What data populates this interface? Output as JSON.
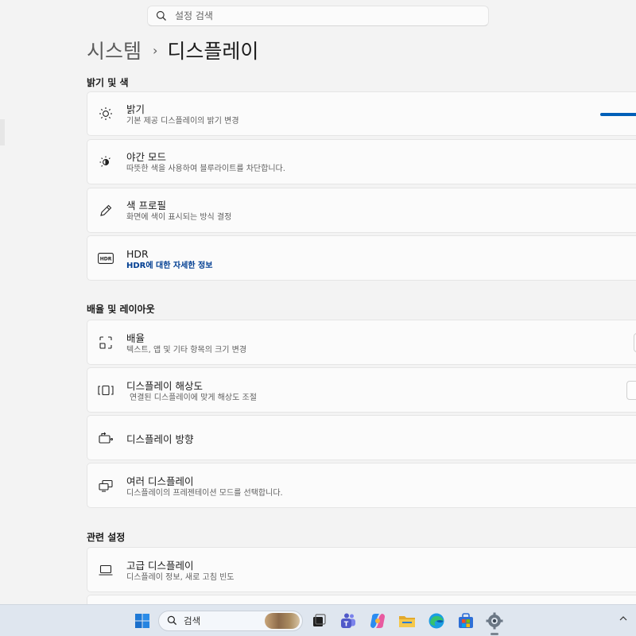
{
  "search": {
    "placeholder": "설정 검색"
  },
  "breadcrumb": {
    "parent": "시스템",
    "separator": "›",
    "current": "디스플레이"
  },
  "sections": {
    "brightness_color": "밝기 및 색",
    "scale_layout": "배율 및 레이아웃",
    "related": "관련 설정"
  },
  "cards": {
    "brightness": {
      "title": "밝기",
      "sub": "기본 제공 디스플레이의 밝기 변경",
      "icon": "sun-icon"
    },
    "night_mode": {
      "title": "야간 모드",
      "sub": "따뜻한 색을 사용하여 블루라이트를 차단합니다.",
      "icon": "night-light-icon"
    },
    "color_profile": {
      "title": "색 프로필",
      "sub": "화면에 색이 표시되는 방식 결정",
      "icon": "pen-icon"
    },
    "hdr": {
      "title": "HDR",
      "sub": "HDR에 대한 자세한 정보",
      "icon": "hdr-icon"
    },
    "scale": {
      "title": "배율",
      "sub": "텍스트, 앱 및 기타 항목의 크기 변경",
      "icon": "scale-icon"
    },
    "resolution": {
      "title": "디스플레이 해상도",
      "sub": "연결된 디스플레이에 맞게 해상도 조절",
      "icon": "resolution-icon"
    },
    "orientation": {
      "title": "디스플레이 방향",
      "icon": "orientation-icon"
    },
    "multiple": {
      "title": "여러 디스플레이",
      "sub": "디스플레이의 프레젠테이션 모드를 선택합니다.",
      "icon": "multi-display-icon"
    },
    "advanced": {
      "title": "고급 디스플레이",
      "sub": "디스플레이 정보, 새로 고침 빈도",
      "icon": "laptop-icon"
    }
  },
  "taskbar": {
    "search_label": "검색",
    "items": [
      "windows-start-icon",
      "task-view-icon",
      "teams-icon",
      "copilot-icon",
      "file-explorer-icon",
      "edge-icon",
      "store-icon",
      "settings-icon"
    ]
  },
  "colors": {
    "accent": "#005fb8",
    "link": "#003e92",
    "background": "#f3f3f3",
    "card": "#fbfbfb"
  }
}
